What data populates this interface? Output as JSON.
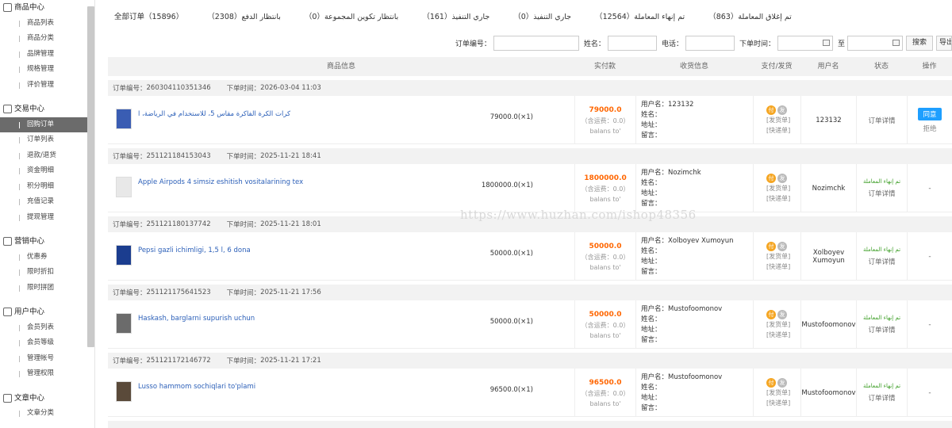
{
  "sidebar": {
    "groups": [
      {
        "title": "商品中心",
        "items": [
          "商品列表",
          "商品分类",
          "品牌管理",
          "规格管理",
          "评价管理"
        ]
      },
      {
        "title": "交易中心",
        "items": [
          "回购订单",
          "订单列表",
          "退款/退货",
          "资金明细",
          "积分明细",
          "充值记录",
          "提现管理"
        ]
      },
      {
        "title": "营销中心",
        "items": [
          "优惠券",
          "限时折扣",
          "限时拼团"
        ]
      },
      {
        "title": "用户中心",
        "items": [
          "会员列表",
          "会员等级",
          "管理帐号",
          "管理权限"
        ]
      },
      {
        "title": "文章中心",
        "items": [
          "文章分类"
        ]
      }
    ],
    "active_item": "回购订单"
  },
  "tabs": [
    "全部订单（15896）",
    "بانتظار الدفع（2308）",
    "بانتظار تكوين المجموعة（0）",
    "جاري التنفيذ（161）",
    "جاري التنفيذ（0）",
    "تم إنهاء المعاملة（12564）",
    "تم إغلاق المعاملة（863）"
  ],
  "search": {
    "order_no_label": "订单编号：",
    "name_label": "姓名：",
    "phone_label": "电话：",
    "time_label": "下单时间：",
    "to_label": "至",
    "search_btn": "搜索",
    "export_btn": "导出"
  },
  "columns": {
    "product": "商品信息",
    "paid": "实付款",
    "receiver": "收货信息",
    "ship": "支付/发货",
    "user": "用户名",
    "status": "状态",
    "op": "操作"
  },
  "labels": {
    "order_no": "订单编号：",
    "order_time": "下单时间：",
    "fee": "（含运费：0.0）",
    "balans": "balans to'",
    "username": "用户名：",
    "name": "姓名：",
    "address": "地址：",
    "message": "留言：",
    "pay_icon": "付",
    "ship_icon": "发",
    "ship_order": "[发货单]",
    "express_order": "[快递单]",
    "detail": "订单详情",
    "agree": "同意",
    "reject": "拒绝",
    "dash": "-"
  },
  "orders": [
    {
      "no": "260304110351346",
      "time": "2026-03-04 11:03",
      "product": "كرات الكرة الفاكرة مقاس 5، للاستخدام في الرياضة، ا",
      "price": "79000.0(×1)",
      "amount": "79000.0",
      "user": "123132",
      "user_name": "123132",
      "status": "",
      "op": "agree",
      "thumb_color": "#3a5db3"
    },
    {
      "no": "251121184153043",
      "time": "2025-11-21 18:41",
      "product": "Apple Airpods 4 simsiz eshitish vositalarining tex",
      "price": "1800000.0(×1)",
      "amount": "1800000.0",
      "user": "Nozimchk",
      "user_name": "Nozimchk",
      "status": "تم إنهاء المعاملة",
      "op": "dash",
      "thumb_color": "#e8e8e8"
    },
    {
      "no": "251121180137742",
      "time": "2025-11-21 18:01",
      "product": "Pepsi gazli ichimligi, 1,5 l, 6 dona",
      "price": "50000.0(×1)",
      "amount": "50000.0",
      "user": "Xolboyev Xumoyun",
      "user_name": "Xolboyev Xumoyun",
      "status": "تم إنهاء المعاملة",
      "op": "dash",
      "thumb_color": "#1b3d8f"
    },
    {
      "no": "251121175641523",
      "time": "2025-11-21 17:56",
      "product": "Haskash, barglarni supurish uchun",
      "price": "50000.0(×1)",
      "amount": "50000.0",
      "user": "Mustofoomonov",
      "user_name": "Mustofoomonov",
      "status": "تم إنهاء المعاملة",
      "op": "dash",
      "thumb_color": "#6b6b6b"
    },
    {
      "no": "251121172146772",
      "time": "2025-11-21 17:21",
      "product": "Lusso hammom sochiqlari to'plami",
      "price": "96500.0(×1)",
      "amount": "96500.0",
      "user": "Mustofoomonov",
      "user_name": "Mustofoomonov",
      "status": "تم إنهاء المعاملة",
      "op": "dash",
      "thumb_color": "#5a4a3a"
    }
  ],
  "watermark": "https://www.huzhan.com/ishop48356"
}
